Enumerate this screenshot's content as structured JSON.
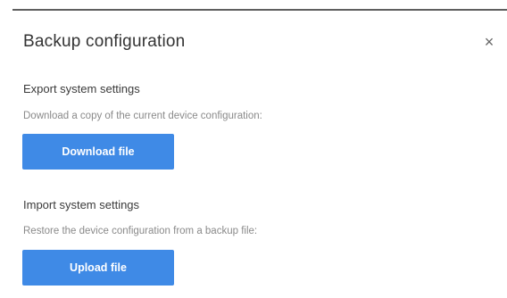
{
  "dialog": {
    "title": "Backup configuration",
    "close_icon": "close-icon",
    "close_glyph": "×"
  },
  "export": {
    "heading": "Export system settings",
    "description": "Download a copy of the current device configuration:",
    "button_label": "Download file"
  },
  "import": {
    "heading": "Import system settings",
    "description": "Restore the device configuration from a backup file:",
    "button_label": "Upload file"
  },
  "colors": {
    "primary_button": "#3f8ae6",
    "title_text": "#333333",
    "muted_text": "#8a8a8a"
  }
}
